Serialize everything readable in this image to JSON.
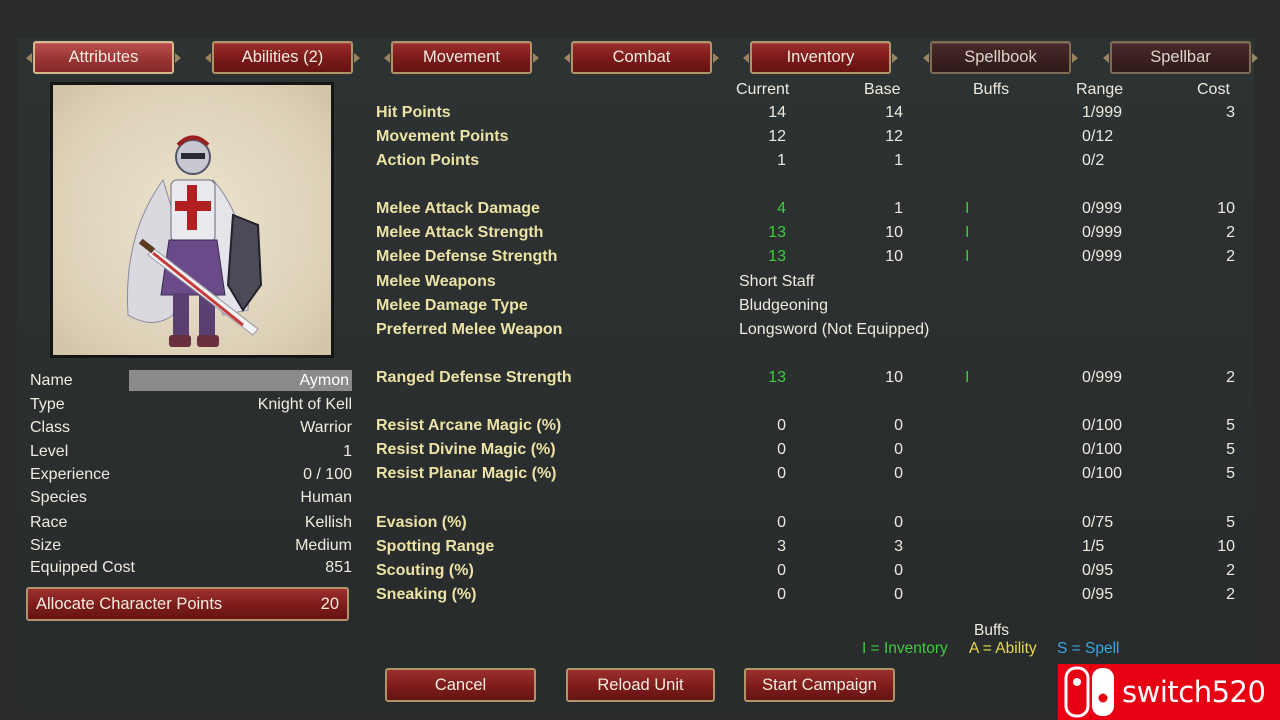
{
  "tabs": [
    {
      "label": "Attributes",
      "state": "active"
    },
    {
      "label": "Abilities (2)",
      "state": "normal"
    },
    {
      "label": "Movement",
      "state": "normal"
    },
    {
      "label": "Combat",
      "state": "normal"
    },
    {
      "label": "Inventory",
      "state": "normal"
    },
    {
      "label": "Spellbook",
      "state": "dim"
    },
    {
      "label": "Spellbar",
      "state": "dim"
    }
  ],
  "character": {
    "rows": [
      {
        "label": "Name",
        "value": "Aymon"
      },
      {
        "label": "Type",
        "value": "Knight of Kell"
      },
      {
        "label": "Class",
        "value": "Warrior"
      },
      {
        "label": "Level",
        "value": "1"
      },
      {
        "label": "Experience",
        "value": "0 / 100"
      },
      {
        "label": "Species",
        "value": "Human"
      },
      {
        "label": "Race",
        "value": "Kellish"
      },
      {
        "label": "Size",
        "value": "Medium"
      },
      {
        "label": "Equipped Cost",
        "value": "851"
      }
    ],
    "allocate_label": "Allocate Character Points",
    "allocate_points": "20"
  },
  "columns": {
    "current": "Current",
    "base": "Base",
    "buffs": "Buffs",
    "range": "Range",
    "cost": "Cost"
  },
  "stats": [
    {
      "label": "Hit Points",
      "current": "14",
      "base": "14",
      "buff": "",
      "range": "1/999",
      "cost": "3",
      "buffed": false
    },
    {
      "label": "Movement Points",
      "current": "12",
      "base": "12",
      "buff": "",
      "range": "0/12",
      "cost": "",
      "buffed": false
    },
    {
      "label": "Action Points",
      "current": "1",
      "base": "1",
      "buff": "",
      "range": "0/2",
      "cost": "",
      "buffed": false
    },
    {
      "label": "Melee Attack Damage",
      "current": "4",
      "base": "1",
      "buff": "I",
      "range": "0/999",
      "cost": "10",
      "buffed": true
    },
    {
      "label": "Melee Attack Strength",
      "current": "13",
      "base": "10",
      "buff": "I",
      "range": "0/999",
      "cost": "2",
      "buffed": true
    },
    {
      "label": "Melee Defense Strength",
      "current": "13",
      "base": "10",
      "buff": "I",
      "range": "0/999",
      "cost": "2",
      "buffed": true
    },
    {
      "label": "Ranged Defense Strength",
      "current": "13",
      "base": "10",
      "buff": "I",
      "range": "0/999",
      "cost": "2",
      "buffed": true
    },
    {
      "label": "Resist Arcane Magic (%)",
      "current": "0",
      "base": "0",
      "buff": "",
      "range": "0/100",
      "cost": "5",
      "buffed": false
    },
    {
      "label": "Resist Divine Magic (%)",
      "current": "0",
      "base": "0",
      "buff": "",
      "range": "0/100",
      "cost": "5",
      "buffed": false
    },
    {
      "label": "Resist Planar Magic (%)",
      "current": "0",
      "base": "0",
      "buff": "",
      "range": "0/100",
      "cost": "5",
      "buffed": false
    },
    {
      "label": "Evasion (%)",
      "current": "0",
      "base": "0",
      "buff": "",
      "range": "0/75",
      "cost": "5",
      "buffed": false
    },
    {
      "label": "Spotting Range",
      "current": "3",
      "base": "3",
      "buff": "",
      "range": "1/5",
      "cost": "10",
      "buffed": false
    },
    {
      "label": "Scouting (%)",
      "current": "0",
      "base": "0",
      "buff": "",
      "range": "0/95",
      "cost": "2",
      "buffed": false
    },
    {
      "label": "Sneaking (%)",
      "current": "0",
      "base": "0",
      "buff": "",
      "range": "0/95",
      "cost": "2",
      "buffed": false
    }
  ],
  "melee_text": [
    {
      "label": "Melee Weapons",
      "value": "Short Staff"
    },
    {
      "label": "Melee Damage Type",
      "value": "Bludgeoning"
    },
    {
      "label": "Preferred Melee Weapon",
      "value": "Longsword (Not Equipped)"
    }
  ],
  "legend": {
    "title": "Buffs",
    "inventory": "I = Inventory",
    "ability": "A = Ability",
    "spell": "S = Spell",
    "colors": {
      "inventory": "#3ecb3e",
      "ability": "#e8d84a",
      "spell": "#3aa7e0"
    }
  },
  "buttons": {
    "cancel": "Cancel",
    "reload": "Reload Unit",
    "start": "Start Campaign"
  },
  "watermark": "switch520",
  "colors": {
    "accent": "#8a2423",
    "stat_label": "#ece2a6",
    "buff_green": "#3ecb3e",
    "logo": "#e60012"
  }
}
